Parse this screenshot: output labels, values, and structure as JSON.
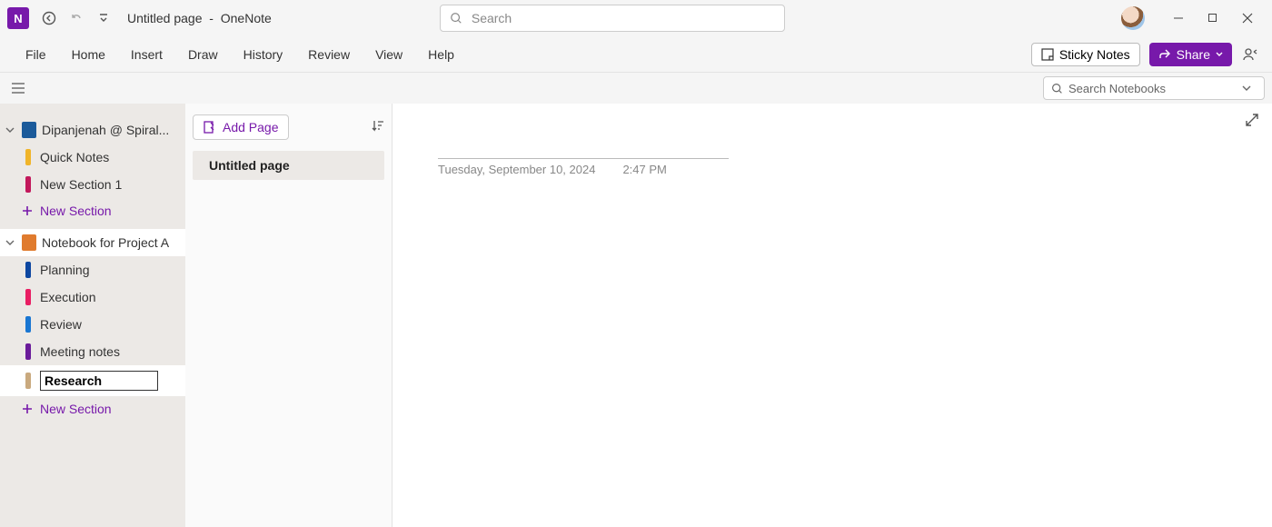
{
  "title": {
    "page": "Untitled page",
    "sep": "-",
    "app": "OneNote"
  },
  "search": {
    "placeholder": "Search"
  },
  "menu": {
    "file": "File",
    "home": "Home",
    "insert": "Insert",
    "draw": "Draw",
    "history": "History",
    "review": "Review",
    "view": "View",
    "help": "Help"
  },
  "buttons": {
    "sticky": "Sticky Notes",
    "share": "Share"
  },
  "nbsearch": {
    "placeholder": "Search Notebooks"
  },
  "sidebar": {
    "nb1": {
      "name": "Dipanjenah @ Spiral..."
    },
    "nb1_sections": {
      "s0": "Quick Notes",
      "s1": "New Section 1"
    },
    "new_section": "New Section",
    "nb2": {
      "name": "Notebook for Project A"
    },
    "nb2_sections": {
      "s0": "Planning",
      "s1": "Execution",
      "s2": "Review",
      "s3": "Meeting notes",
      "s4_value": "Research"
    }
  },
  "pages": {
    "add": "Add Page",
    "p0": "Untitled page"
  },
  "canvas": {
    "date": "Tuesday, September 10, 2024",
    "time": "2:47 PM"
  },
  "colors": {
    "purple": "#7719aa",
    "nb1": "#1b5a9a",
    "nb2": "#e07b2e",
    "sec_yellow": "#f0b429",
    "sec_magenta": "#c2185b",
    "sec_blue": "#0d47a1",
    "sec_pink": "#e91e63",
    "sec_blue2": "#1976d2",
    "sec_purple": "#6a1b9a",
    "sec_tan": "#c9a97e"
  }
}
